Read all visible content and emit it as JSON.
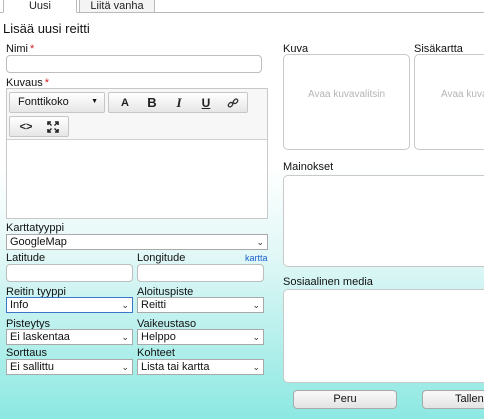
{
  "tabs": [
    {
      "label": "Uusi",
      "active": true
    },
    {
      "label": "Liitä vanha",
      "active": false
    }
  ],
  "page_title": "Lisää uusi reitti",
  "form": {
    "name_label": "Nimi",
    "name_value": "",
    "description_label": "Kuvaus",
    "required_mark": "*",
    "editor": {
      "format_select": "Fonttikoko",
      "buttons": [
        "A",
        "B",
        "I",
        "U",
        "link",
        "code",
        "fullscreen"
      ],
      "content": ""
    },
    "map_type": {
      "label": "Karttatyyppi",
      "value": "GoogleMap"
    },
    "latitude": {
      "label": "Latitude",
      "value": ""
    },
    "longitude": {
      "label": "Longitude",
      "value": ""
    },
    "map_link": "kartta",
    "route_type": {
      "label": "Reitin tyyppi",
      "value": "Info"
    },
    "start_point": {
      "label": "Aloituspiste",
      "value": "Reitti"
    },
    "scoring": {
      "label": "Pisteytys",
      "value": "Ei laskentaa"
    },
    "difficulty": {
      "label": "Vaikeustaso",
      "value": "Helppo"
    },
    "sorting": {
      "label": "Sorttaus",
      "value": "Ei sallittu"
    },
    "targets": {
      "label": "Kohteet",
      "value": "Lista tai kartta"
    }
  },
  "media": {
    "image_label": "Kuva",
    "image_placeholder": "Avaa kuvavalitsin",
    "inner_map_label": "Sisäkartta",
    "inner_map_placeholder": "Avaa kuvavalitsin",
    "ads_label": "Mainokset",
    "social_label": "Sosiaalinen media"
  },
  "actions": {
    "cancel": "Peru",
    "save": "Tallenna"
  }
}
